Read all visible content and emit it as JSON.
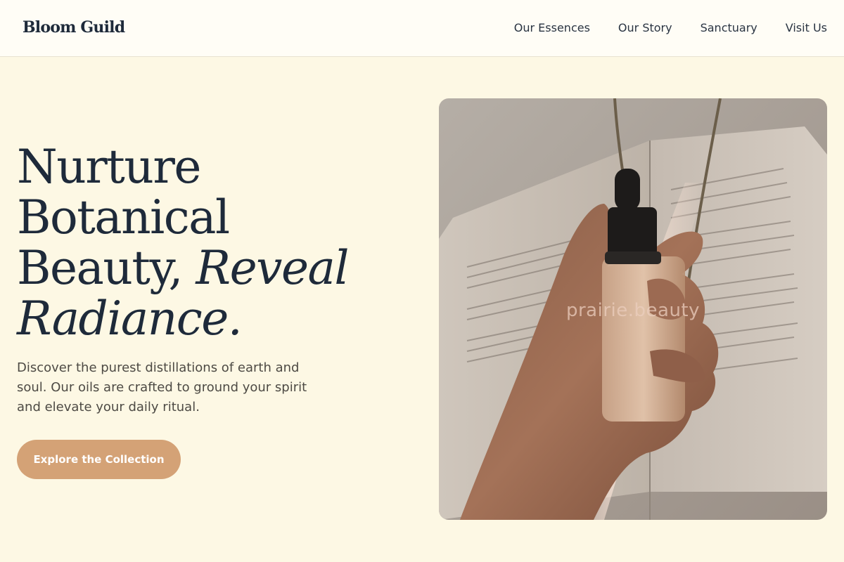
{
  "header": {
    "logo": "Bloom Guild",
    "nav": [
      "Our Essences",
      "Our Story",
      "Sanctuary",
      "Visit Us"
    ]
  },
  "hero": {
    "title_line1": "Nurture",
    "title_line2": "Botanical",
    "title_line3_plain": "Beauty, ",
    "title_line3_italic": "Reveal",
    "title_line4_italic": "Radiance.",
    "description": "Discover the purest distillations of earth and soul. Our oils are crafted to ground your spirit and elevate your daily ritual.",
    "cta_label": "Explore the Collection",
    "image_watermark": "prairie.beauty"
  },
  "colors": {
    "background": "#fdf8e4",
    "header_bg": "#fffdf6",
    "text_primary": "#1e2a3a",
    "accent": "#d4a276"
  }
}
